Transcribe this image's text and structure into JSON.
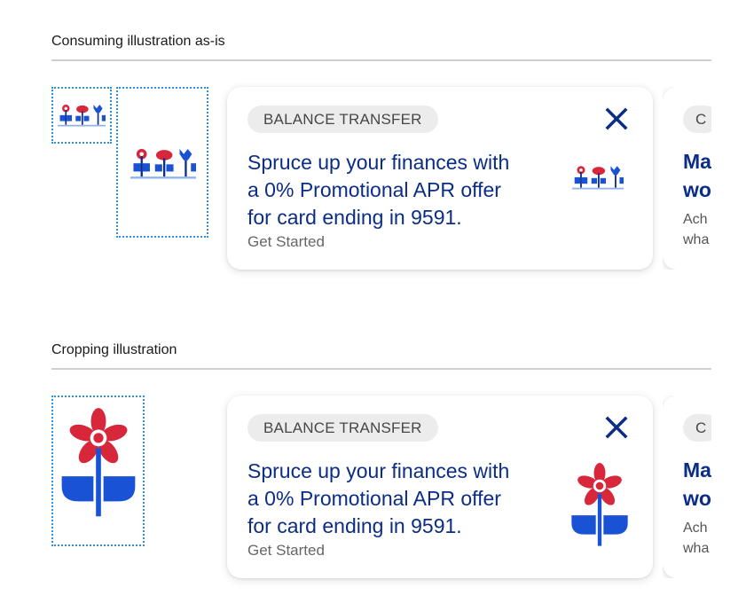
{
  "sections": [
    {
      "title": "Consuming illustration as-is",
      "card": {
        "chip": "BALANCE TRANSFER",
        "headline_lines": [
          "Spruce up your finances with",
          "a 0% Promotional APR offer",
          "for card ending in 9591."
        ],
        "cta": "Get Started",
        "close_icon": "close-icon"
      },
      "next_card": {
        "chip": "C",
        "headline_lines": [
          "Ma",
          "wo"
        ],
        "body_lines": [
          "Ach",
          "wha"
        ]
      }
    },
    {
      "title": "Cropping illustration",
      "card": {
        "chip": "BALANCE TRANSFER",
        "headline_lines": [
          "Spruce up your finances with",
          "a 0% Promotional APR offer",
          "for card ending in 9591."
        ],
        "cta": "Get Started",
        "close_icon": "close-icon"
      },
      "next_card": {
        "chip": "C",
        "headline_lines": [
          "Ma",
          "wo"
        ],
        "body_lines": [
          "Ach",
          "wha"
        ]
      }
    }
  ],
  "colors": {
    "navy": "#0b2d86",
    "flower_red": "#d8263a",
    "leaf_blue": "#1a52d6",
    "dashed_border": "#2d8fe6"
  },
  "icons": [
    "flower-garden-icon",
    "flower-icon",
    "close-icon"
  ]
}
